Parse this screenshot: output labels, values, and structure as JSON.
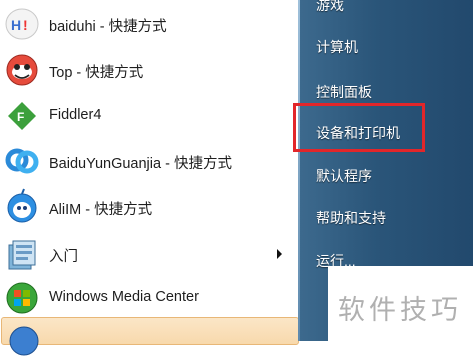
{
  "programs": [
    {
      "label": "baiduhi - 快捷方式",
      "icon": "baiduhi-icon"
    },
    {
      "label": "Top - 快捷方式",
      "icon": "top-icon"
    },
    {
      "label": "Fiddler4",
      "icon": "fiddler-icon"
    },
    {
      "label": "BaiduYunGuanjia - 快捷方式",
      "icon": "baiduyun-icon"
    },
    {
      "label": "AliIM - 快捷方式",
      "icon": "aliim-icon"
    },
    {
      "label": "入门",
      "icon": "getting-started-icon"
    },
    {
      "label": "Windows Media Center",
      "icon": "windows-media-center-icon"
    }
  ],
  "right_pane": {
    "items": [
      "游戏",
      "计算机",
      "控制面板",
      "设备和打印机",
      "默认程序",
      "帮助和支持",
      "运行..."
    ],
    "highlighted": "设备和打印机",
    "highlight_color": "#e2262a"
  },
  "watermark": {
    "text": "软件技巧"
  }
}
